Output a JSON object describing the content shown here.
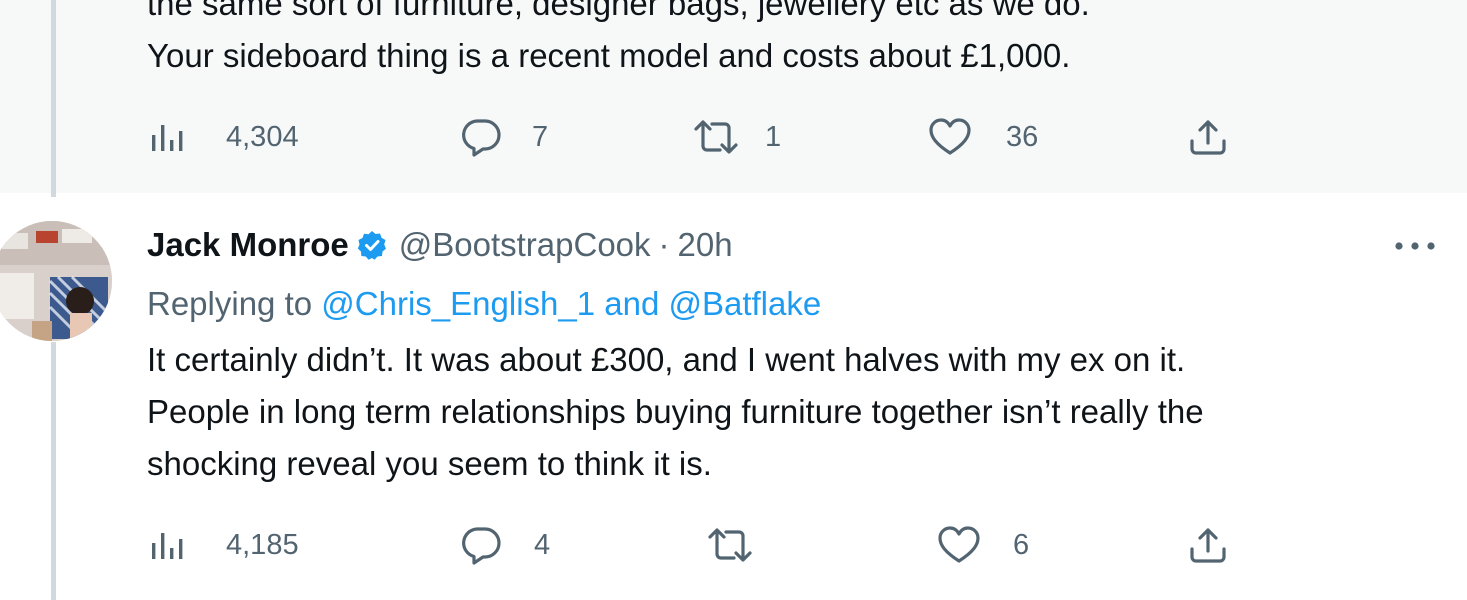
{
  "previous_tweet": {
    "text_lines": [
      "the same sort of furniture, designer bags, jewellery etc as we do.",
      "Your sideboard thing is a recent model and costs about £1,000."
    ],
    "views": "4,304",
    "replies": "7",
    "retweets": "1",
    "likes": "36"
  },
  "tweet": {
    "author_name": "Jack Monroe",
    "handle": "@BootstrapCook",
    "separator": "·",
    "time": "20h",
    "replying_prefix": "Replying to",
    "mention_1": "@Chris_English_1",
    "mention_joiner": "and",
    "mention_2": "@Batflake",
    "text_lines": [
      "It certainly didn’t. It was about £300, and I went halves with my ex on it.",
      "People in long term relationships buying furniture together isn’t really the",
      "shocking reveal you seem to think it is."
    ],
    "views": "4,185",
    "replies": "4",
    "retweets": "",
    "likes": "6"
  },
  "icons": {
    "views": "views-icon",
    "reply": "reply-icon",
    "retweet": "retweet-icon",
    "like": "like-icon",
    "share": "share-icon",
    "verified": "verified-badge-icon",
    "more": "more-icon"
  },
  "colors": {
    "text": "#0f1419",
    "secondary": "#536471",
    "link": "#1d9bf0",
    "thread_line": "#cfd9de",
    "hover_bg": "#f7f9f9"
  }
}
